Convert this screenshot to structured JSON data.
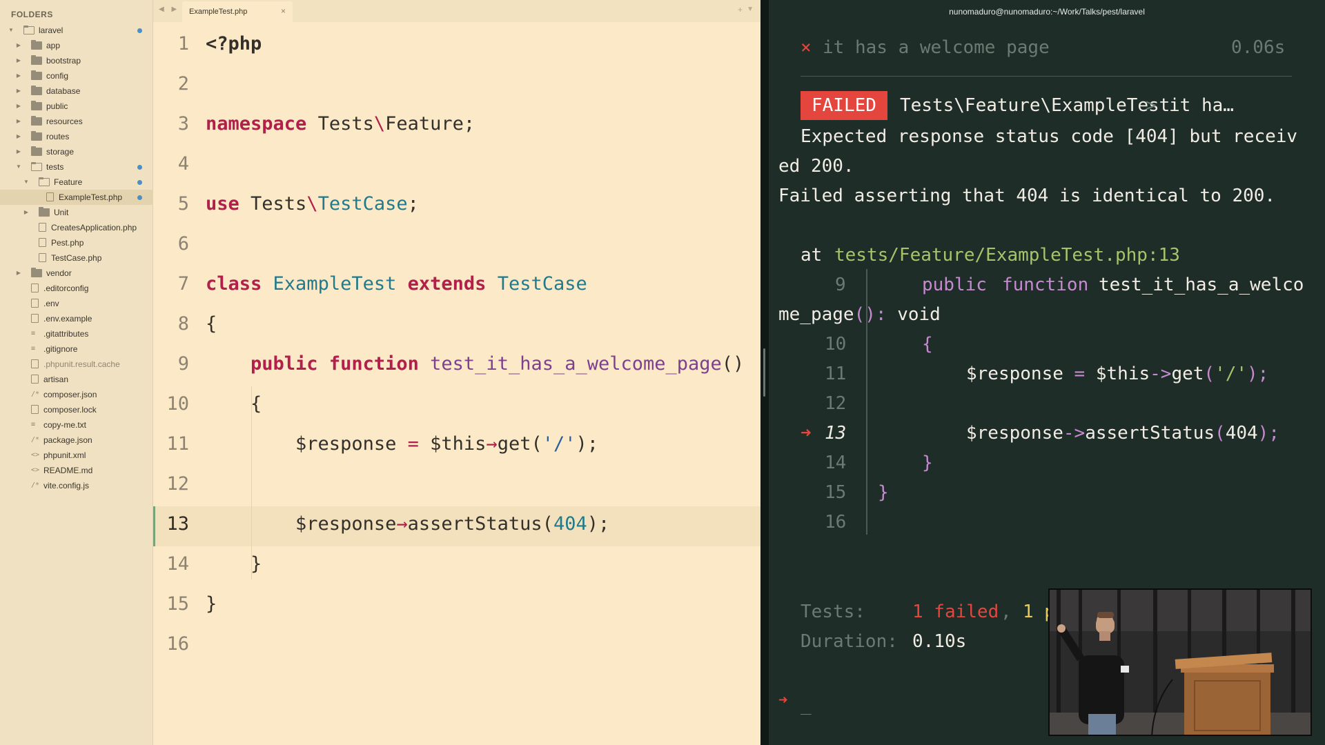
{
  "sidebar": {
    "title": "FOLDERS",
    "items": [
      {
        "label": "laravel",
        "type": "folder-open",
        "depth": 0,
        "expanded": true,
        "modified": true
      },
      {
        "label": "app",
        "type": "folder",
        "depth": 1,
        "expanded": false
      },
      {
        "label": "bootstrap",
        "type": "folder",
        "depth": 1,
        "expanded": false
      },
      {
        "label": "config",
        "type": "folder",
        "depth": 1,
        "expanded": false
      },
      {
        "label": "database",
        "type": "folder",
        "depth": 1,
        "expanded": false
      },
      {
        "label": "public",
        "type": "folder",
        "depth": 1,
        "expanded": false
      },
      {
        "label": "resources",
        "type": "folder",
        "depth": 1,
        "expanded": false
      },
      {
        "label": "routes",
        "type": "folder",
        "depth": 1,
        "expanded": false
      },
      {
        "label": "storage",
        "type": "folder",
        "depth": 1,
        "expanded": false
      },
      {
        "label": "tests",
        "type": "folder-open",
        "depth": 1,
        "expanded": true,
        "modified": true
      },
      {
        "label": "Feature",
        "type": "folder-open",
        "depth": 2,
        "expanded": true,
        "modified": true
      },
      {
        "label": "ExampleTest.php",
        "type": "file",
        "depth": 3,
        "selected": true,
        "modified": true
      },
      {
        "label": "Unit",
        "type": "folder",
        "depth": 2,
        "expanded": false
      },
      {
        "label": "CreatesApplication.php",
        "type": "file",
        "depth": 2
      },
      {
        "label": "Pest.php",
        "type": "file",
        "depth": 2
      },
      {
        "label": "TestCase.php",
        "type": "file",
        "depth": 2
      },
      {
        "label": "vendor",
        "type": "folder",
        "depth": 1,
        "expanded": false
      },
      {
        "label": ".editorconfig",
        "type": "file",
        "depth": 1
      },
      {
        "label": ".env",
        "type": "file",
        "depth": 1
      },
      {
        "label": ".env.example",
        "type": "file",
        "depth": 1
      },
      {
        "label": ".gitattributes",
        "type": "lines",
        "depth": 1
      },
      {
        "label": ".gitignore",
        "type": "lines",
        "depth": 1
      },
      {
        "label": ".phpunit.result.cache",
        "type": "file",
        "depth": 1,
        "dim": true
      },
      {
        "label": "artisan",
        "type": "file",
        "depth": 1
      },
      {
        "label": "composer.json",
        "type": "slash",
        "depth": 1
      },
      {
        "label": "composer.lock",
        "type": "file",
        "depth": 1
      },
      {
        "label": "copy-me.txt",
        "type": "lines",
        "depth": 1
      },
      {
        "label": "package.json",
        "type": "slash",
        "depth": 1
      },
      {
        "label": "phpunit.xml",
        "type": "angle",
        "depth": 1
      },
      {
        "label": "README.md",
        "type": "angle",
        "depth": 1
      },
      {
        "label": "vite.config.js",
        "type": "slash",
        "depth": 1
      }
    ]
  },
  "editor": {
    "nav_arrows": "◀ ▶",
    "tab_label": "ExampleTest.php",
    "tab_close": "×",
    "tab_plus": "+",
    "tab_dropdown": "▼",
    "active_line": 13,
    "lines": [
      {
        "n": "1",
        "html": "<?php"
      },
      {
        "n": "2",
        "html": ""
      },
      {
        "n": "3",
        "html": "namespace Tests\\Feature;"
      },
      {
        "n": "4",
        "html": ""
      },
      {
        "n": "5",
        "html": "use Tests\\TestCase;"
      },
      {
        "n": "6",
        "html": ""
      },
      {
        "n": "7",
        "html": "class ExampleTest extends TestCase"
      },
      {
        "n": "8",
        "html": "{"
      },
      {
        "n": "9",
        "html": "    public function test_it_has_a_welcome_page()"
      },
      {
        "n": "10",
        "html": "    {"
      },
      {
        "n": "11",
        "html": "        $response = $this→get('/');"
      },
      {
        "n": "12",
        "html": ""
      },
      {
        "n": "13",
        "html": "        $response→assertStatus(404);"
      },
      {
        "n": "14",
        "html": "    }"
      },
      {
        "n": "15",
        "html": "}"
      },
      {
        "n": "16",
        "html": ""
      }
    ]
  },
  "terminal": {
    "title": "nunomaduro@nunomaduro:~/Work/Talks/pest/laravel",
    "fail_mark": "×",
    "test_name": "it has a welcome page",
    "test_time": "0.06s",
    "badge": "FAILED",
    "failed_class": "Tests\\Feature\\ExampleTest",
    "failed_sep": ">",
    "failed_desc": "it ha…",
    "message_1": "Expected response status code [404] but receiv",
    "message_2": "ed 200.",
    "message_3": "Failed asserting that 404 is identical to 200.",
    "at_label": "at",
    "at_path": "tests/Feature/ExampleTest.php:13",
    "snippet": [
      {
        "n": "9",
        "code_a": "public",
        "code_b": "function",
        "code_c": "test_it_has_a_welco"
      },
      {
        "wrap": "me_page(): void"
      },
      {
        "n": "10",
        "code": "{"
      },
      {
        "n": "11",
        "code": "$response = $this->get('/');"
      },
      {
        "n": "12",
        "code": ""
      },
      {
        "n": "13",
        "code": "$response->assertStatus(404);",
        "arrow": "➜"
      },
      {
        "n": "14",
        "code": "}"
      },
      {
        "n": "15",
        "code": "}"
      },
      {
        "n": "16",
        "code": ""
      }
    ],
    "tests_label": "Tests:",
    "tests_failed": "1 failed",
    "tests_sep": ",",
    "tests_passed_partial": "1 p",
    "duration_label": "Duration:",
    "duration_value": "0.10s",
    "prompt_arrow": "➜",
    "cursor": "_"
  },
  "colors": {
    "editor_bg": "#fbe9c8",
    "sidebar_bg": "#efe1c1",
    "terminal_bg": "#1f2d29",
    "fail_red": "#e4463e",
    "path_green": "#a7c46b",
    "keyword_red": "#b11f4a",
    "class_teal": "#217a8c"
  }
}
